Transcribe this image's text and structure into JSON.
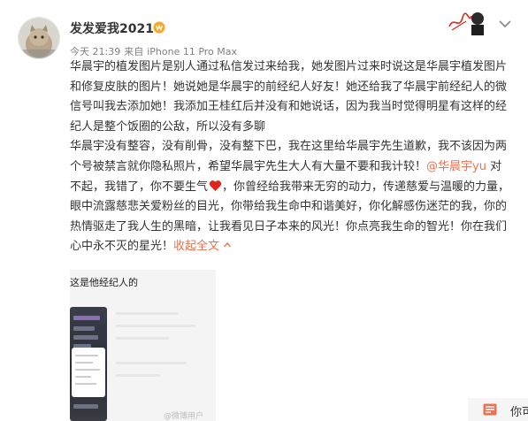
{
  "post": {
    "username": "发发爱我2021",
    "meta": {
      "time": "今天 21:39",
      "source_prefix": "来自",
      "device": "iPhone 11 Pro Max"
    },
    "text": {
      "p1": "华晨宇的植发图片是别人通过私信发过来给我，她发图片过来时说这是华晨宇植发图片和修复皮肤的图片！她说她是华晨宇的前经纪人好友！她还给我了华晨宇前经纪人的微信号叫我去添加她！我添加王桂红后并没有和她说话，因为我当时觉得明星有这样的经纪人是整个饭圈的公敌，所以没有多聊",
      "p2_a": "华晨宇没有整容，没有削骨，没有整下巴，我在这里给华晨宇先生道歉，我不该因为两个号被禁言就你隐私照片，希望华晨宇先生大人有大量不要和我计较！",
      "mention": "@华晨宇yu",
      "p2_b": " 对不起，我错了，你不要生气",
      "p2_c": "，你曾经给我带来无穷的动力，传递慈爱与温暖的力量，眼中流露慈悲关爱粉丝的目光，你带给我生命中和谐美好，你化解感伤迷茫的我，你的热情驱走了我人生的黑暗，让我看见日子本来的风光！你点亮我生命的智光！你在我们心中永不灭的星光！",
      "collapse": "收起全文"
    },
    "image": {
      "caption": "这是他经纪人的",
      "watermark": "@微博用户"
    }
  },
  "actions": {
    "comment_label": "你可"
  },
  "colors": {
    "accent": "#eb7350",
    "heart": "#e2231a"
  },
  "icons": [
    "vip-badge-icon",
    "signature-icon",
    "chevron-down-icon",
    "heart-icon",
    "chevron-up-icon",
    "comment-icon"
  ]
}
